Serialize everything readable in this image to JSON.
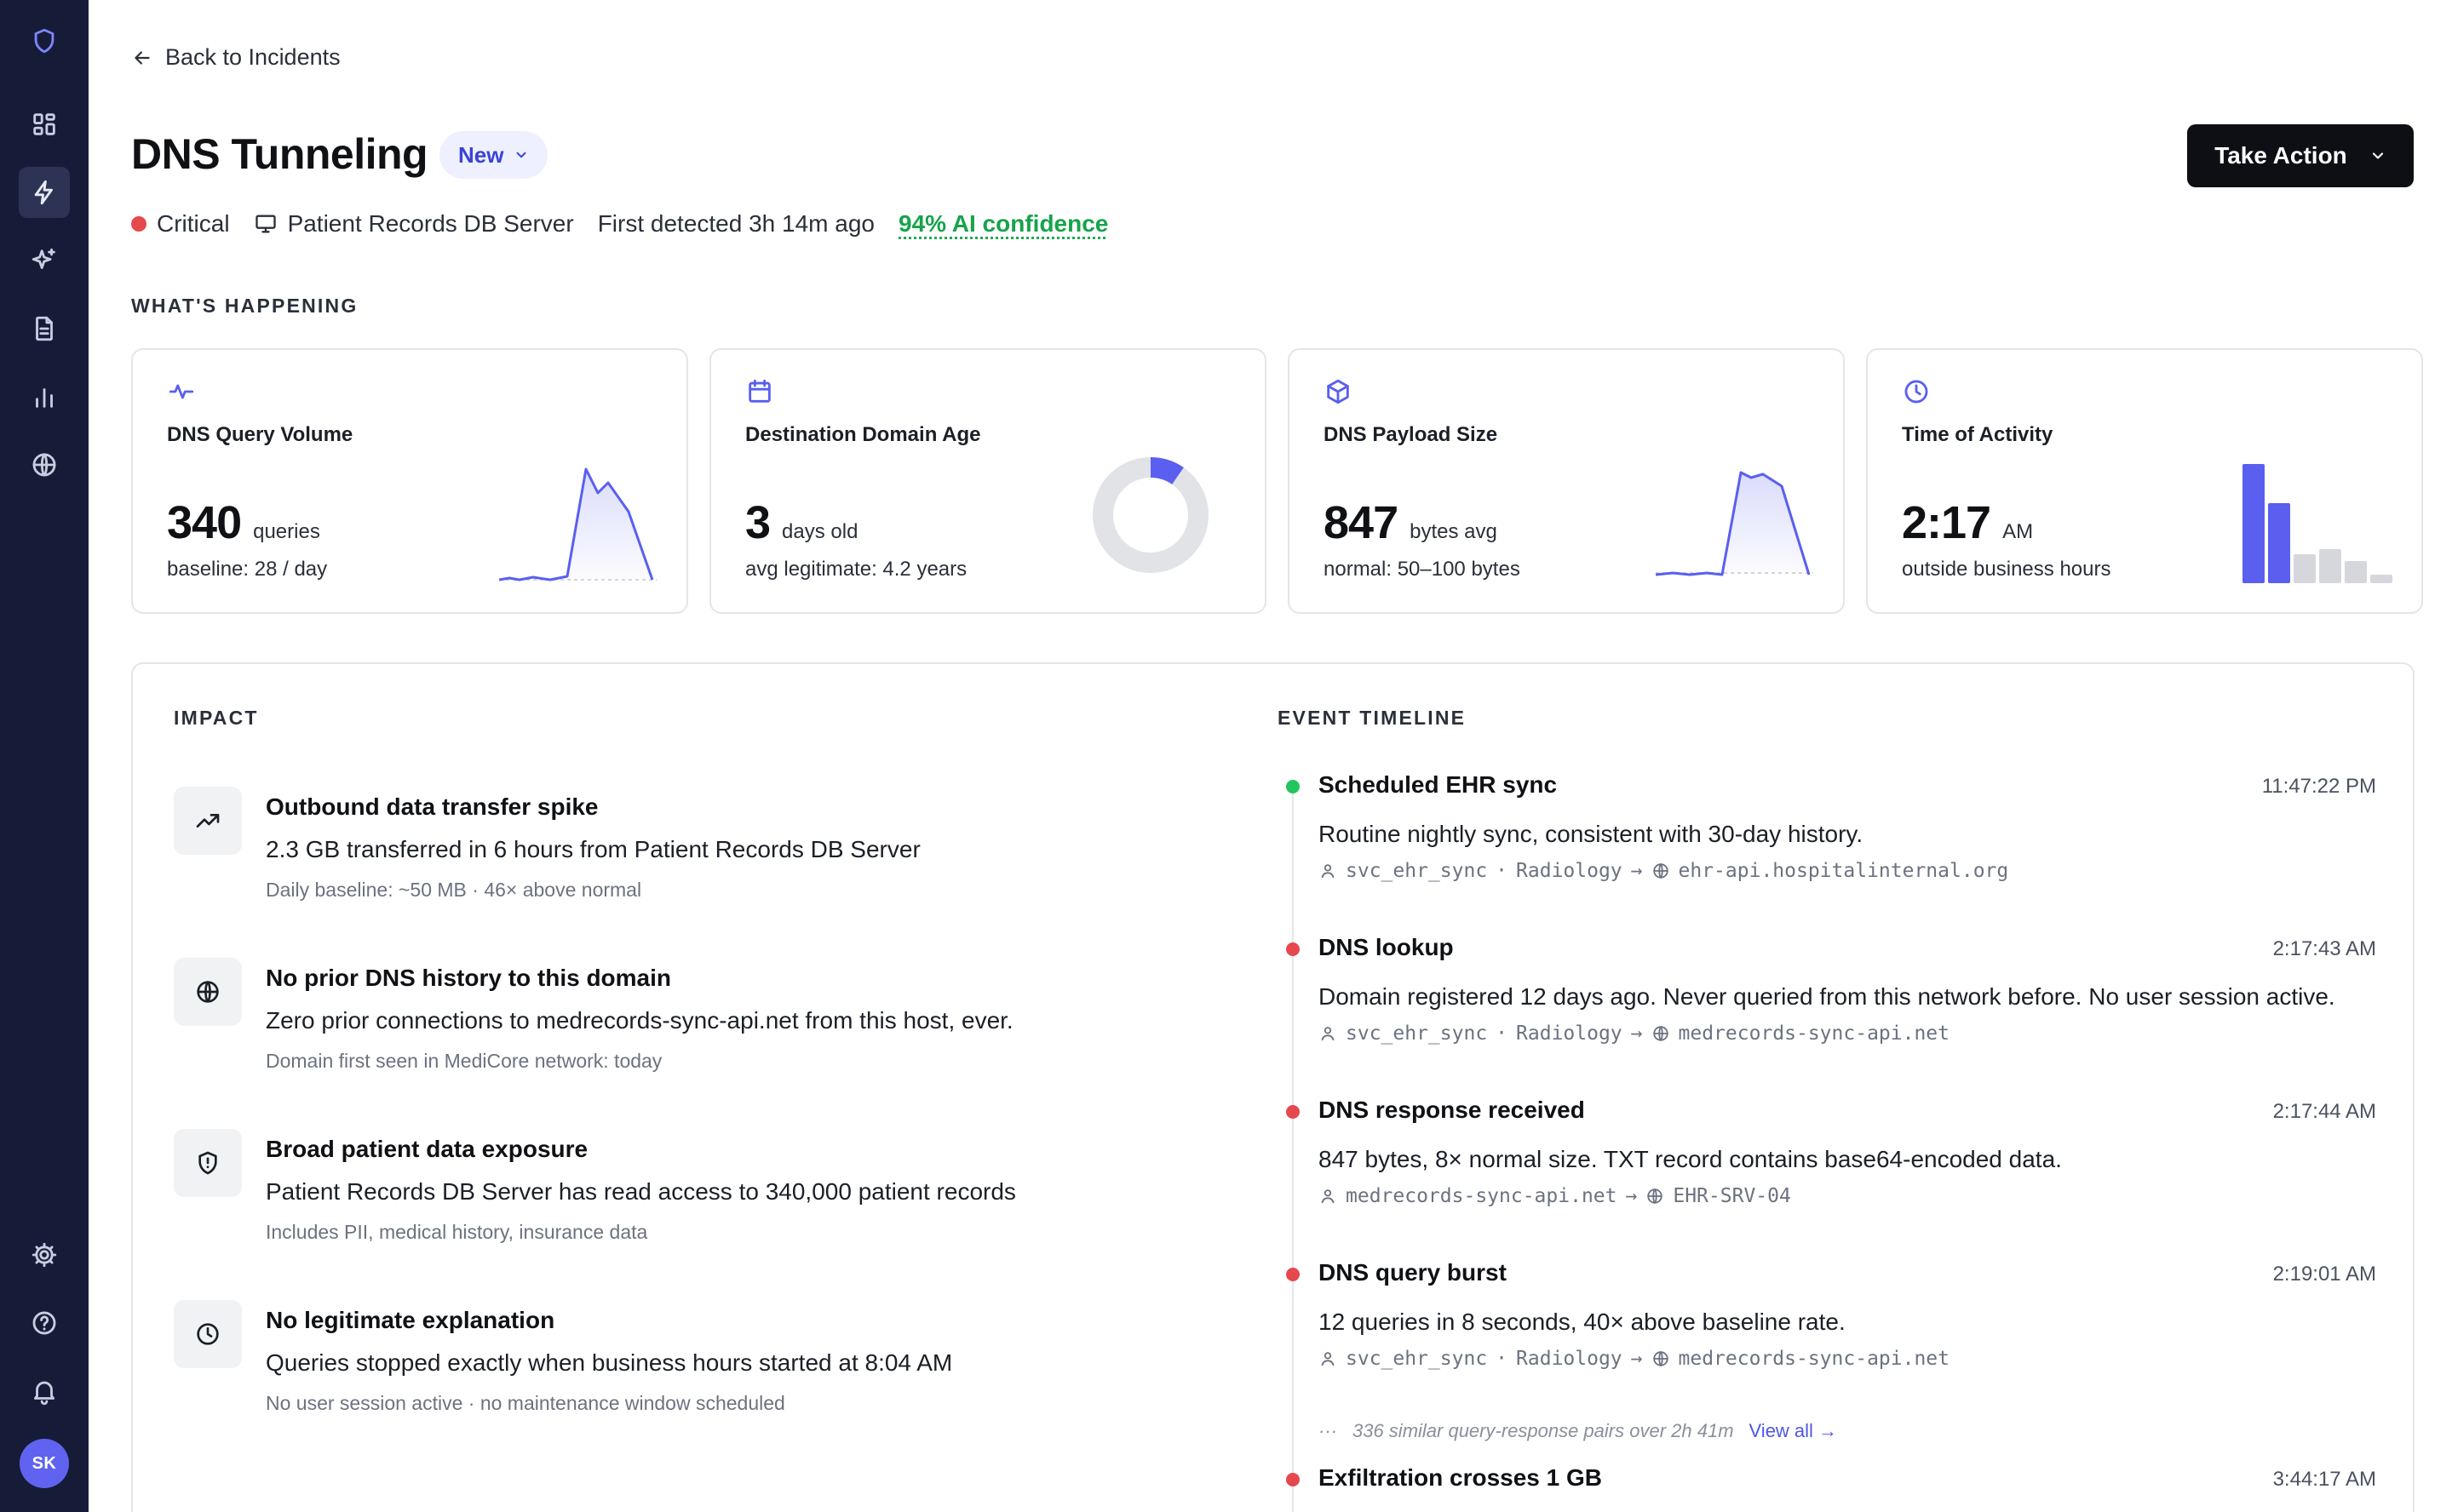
{
  "sidebar": {
    "items": [
      {
        "icon": "dashboard-icon"
      },
      {
        "icon": "incidents-bolt-icon",
        "active": true
      },
      {
        "icon": "ai-sparkle-icon"
      },
      {
        "icon": "document-icon"
      },
      {
        "icon": "analytics-bars-icon"
      },
      {
        "icon": "globe-icon"
      }
    ],
    "bottom": [
      {
        "icon": "settings-gear-icon"
      },
      {
        "icon": "help-icon"
      },
      {
        "icon": "bell-icon"
      }
    ],
    "avatar_initials": "SK"
  },
  "header": {
    "back_label": "Back to Incidents",
    "title": "DNS Tunneling",
    "status": "New",
    "action_label": "Take Action",
    "severity": "Critical",
    "asset": "Patient Records DB Server",
    "detected": "First detected 3h 14m ago",
    "confidence": "94% AI confidence"
  },
  "colors": {
    "accent": "#5a5ff0",
    "critical": "#e5484d",
    "success": "#16a34a",
    "sidebar_bg": "#161c38"
  },
  "whats_happening": {
    "label": "WHAT'S HAPPENING",
    "cards": [
      {
        "icon": "activity-pulse-icon",
        "title": "DNS Query Volume",
        "value": "340",
        "unit": "queries",
        "sub": "baseline: 28 / day"
      },
      {
        "icon": "calendar-icon",
        "title": "Destination Domain Age",
        "value": "3",
        "unit": "days old",
        "sub": "avg legitimate: 4.2 years"
      },
      {
        "icon": "package-box-icon",
        "title": "DNS Payload Size",
        "value": "847",
        "unit": "bytes avg",
        "sub": "normal: 50–100 bytes"
      },
      {
        "icon": "clock-icon",
        "title": "Time of Activity",
        "value": "2:17",
        "unit": "AM",
        "sub": "outside business hours"
      }
    ]
  },
  "impact": {
    "label": "IMPACT",
    "items": [
      {
        "icon": "trending-up-icon",
        "title": "Outbound data transfer spike",
        "desc": "2.3 GB transferred in 6 hours from Patient Records DB Server",
        "note": "Daily baseline: ~50 MB · 46× above normal"
      },
      {
        "icon": "globe-icon",
        "title": "No prior DNS history to this domain",
        "desc": "Zero prior connections to medrecords-sync-api.net from this host, ever.",
        "note": "Domain first seen in MediCore network: today"
      },
      {
        "icon": "shield-alert-icon",
        "title": "Broad patient data exposure",
        "desc": "Patient Records DB Server has read access to 340,000 patient records",
        "note": "Includes PII, medical history, insurance data"
      },
      {
        "icon": "clock-icon",
        "title": "No legitimate explanation",
        "desc": "Queries stopped exactly when business hours started at 8:04 AM",
        "note": "No user session active · no maintenance window scheduled"
      }
    ]
  },
  "timeline": {
    "label": "EVENT TIMELINE",
    "events": [
      {
        "status": "ok",
        "title": "Scheduled EHR sync",
        "time": "11:47:22 PM",
        "desc": "Routine nightly sync, consistent with 30-day history.",
        "user": "svc_ehr_sync",
        "dept": "Radiology",
        "arrow": "→",
        "dest": "ehr-api.hospitalinternal.org"
      },
      {
        "status": "critical",
        "title": "DNS lookup",
        "time": "2:17:43 AM",
        "desc": "Domain registered 12 days ago. Never queried from this network before. No user session active.",
        "user": "svc_ehr_sync",
        "dept": "Radiology",
        "arrow": "→",
        "dest": "medrecords-sync-api.net"
      },
      {
        "status": "critical",
        "title": "DNS response received",
        "time": "2:17:44 AM",
        "desc": "847 bytes, 8× normal size. TXT record contains base64-encoded data.",
        "user": "medrecords-sync-api.net",
        "arrow": "→",
        "dest": "EHR-SRV-04"
      },
      {
        "status": "critical",
        "title": "DNS query burst",
        "time": "2:19:01 AM",
        "desc": "12 queries in 8 seconds, 40× above baseline rate.",
        "user": "svc_ehr_sync",
        "dept": "Radiology",
        "arrow": "→",
        "dest": "medrecords-sync-api.net"
      },
      {
        "status": "critical",
        "title": "Exfiltration crosses 1 GB",
        "time": "3:44:17 AM"
      }
    ],
    "similar_text": "336 similar query-response pairs over 2h 41m",
    "view_all": "View all →",
    "separator": "·"
  }
}
